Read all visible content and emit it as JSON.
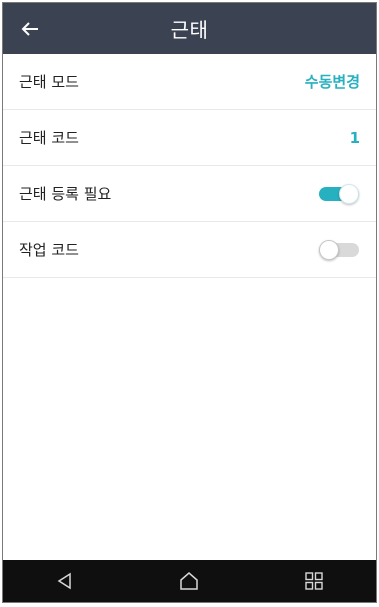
{
  "header": {
    "title": "근태",
    "back_icon": "back-arrow-icon"
  },
  "settings": [
    {
      "label": "근태 모드",
      "type": "value",
      "value": "수동변경"
    },
    {
      "label": "근태 코드",
      "type": "value",
      "value": "1"
    },
    {
      "label": "근태 등록 필요",
      "type": "toggle",
      "on": true
    },
    {
      "label": "작업 코드",
      "type": "toggle",
      "on": false
    }
  ],
  "nav": {
    "icons": [
      "back-triangle-icon",
      "home-icon",
      "recents-icon"
    ]
  },
  "colors": {
    "header_bg": "#3b4252",
    "accent": "#27b0bf",
    "toggle_off": "#d9d9d9",
    "nav_bg": "#0f0f0f"
  }
}
